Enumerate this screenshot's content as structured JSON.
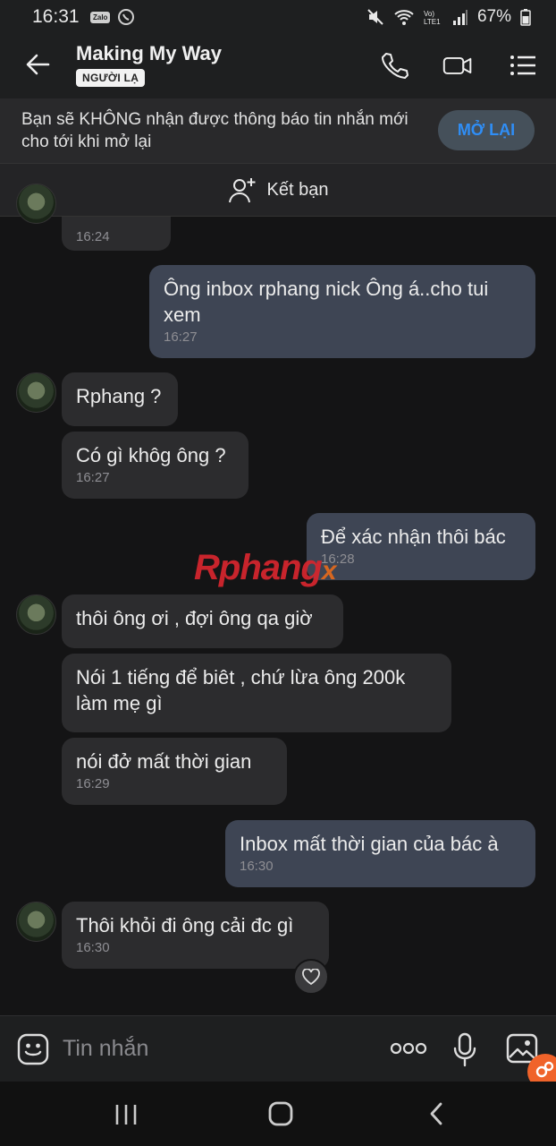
{
  "status_bar": {
    "time": "16:31",
    "left_icons": [
      "zalo-icon",
      "viber-icon"
    ],
    "zalo_label": "Zalo",
    "battery": "67%",
    "right_icons": [
      "mute-icon",
      "wifi-icon",
      "volte-icon",
      "signal-icon",
      "battery-icon"
    ]
  },
  "header": {
    "title": "Making My Way",
    "tag": "NGƯỜI LẠ"
  },
  "notice": {
    "text": "Bạn sẽ KHÔNG nhận được thông báo tin nhắn mới cho tới khi mở lại",
    "button": "MỞ LẠI"
  },
  "add_friend": {
    "label": "Kết bạn"
  },
  "messages": [
    {
      "from": "them",
      "text": "",
      "time": "16:24"
    },
    {
      "from": "me",
      "text": "Ông inbox rphang nick Ông á..cho tui xem",
      "time": "16:27"
    },
    {
      "from": "them",
      "text": "Rphang ?",
      "time": ""
    },
    {
      "from": "them",
      "text": "Có gì khôg ông ?",
      "time": "16:27"
    },
    {
      "from": "me",
      "text": "Để xác nhận thôi bác",
      "time": "16:28"
    },
    {
      "from": "them",
      "text": "thôi ông ơi , đợi ông qa giờ",
      "time": ""
    },
    {
      "from": "them",
      "text": "Nói 1 tiếng để biêt , chứ lừa ông 200k làm mẹ gì",
      "time": ""
    },
    {
      "from": "them",
      "text": "nói đở mất thời gian",
      "time": "16:29"
    },
    {
      "from": "me",
      "text": "Inbox mất thời gian của bác à",
      "time": "16:30"
    },
    {
      "from": "them",
      "text": "Thôi khỏi đi ông cải đc gì",
      "time": "16:30"
    }
  ],
  "watermark": {
    "main": "Rphang",
    "suffix": "x"
  },
  "input": {
    "placeholder": "Tin nhắn"
  },
  "colors": {
    "background": "#141415",
    "bubble_in": "#2c2c2e",
    "bubble_out": "#3e4554",
    "accent": "#2f8ef6"
  }
}
